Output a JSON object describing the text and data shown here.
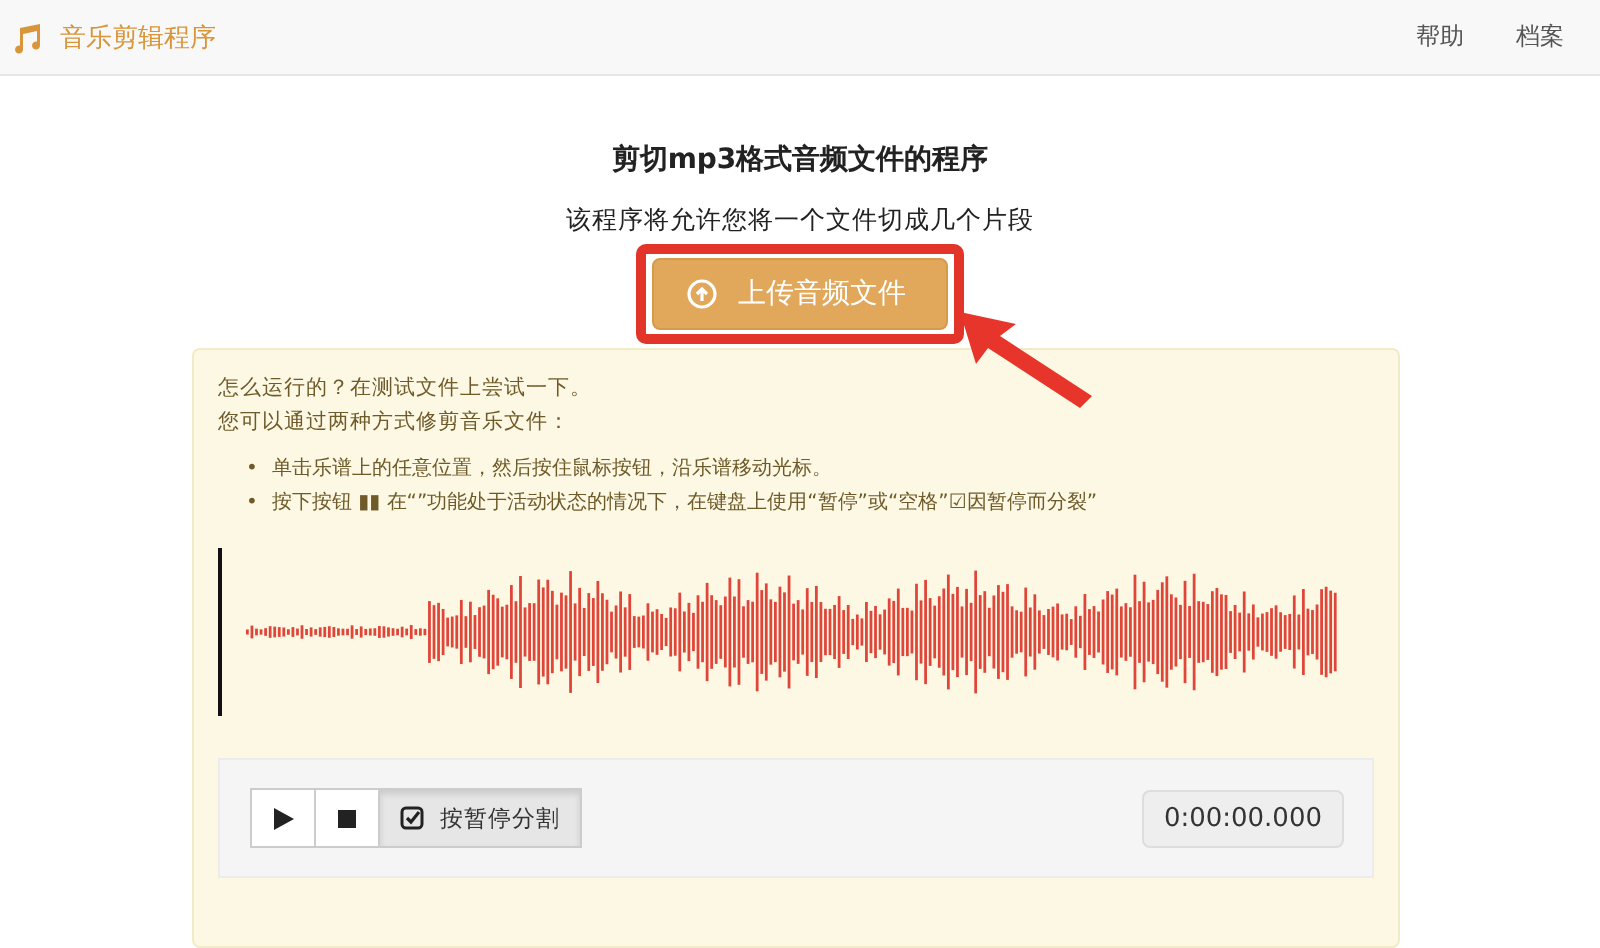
{
  "navbar": {
    "brand": "音乐剪辑程序",
    "links": [
      "帮助",
      "档案"
    ]
  },
  "heading": "剪切mp3格式音频文件的程序",
  "subtitle": "该程序将允许您将一个文件切成几个片段",
  "upload_button": {
    "label": "上传音频文件",
    "highlighted": true
  },
  "instructions": {
    "lines": [
      "怎么运行的？在测试文件上尝试一下。",
      "您可以通过两种方式修剪音乐文件："
    ],
    "bullets": [
      {
        "marker": "•",
        "text": "单击乐谱上的任意位置，然后按住鼠标按钮，沿乐谱移动光标。"
      },
      {
        "marker": "•",
        "text": "按下按钮 ▮▮ 在“”功能处于活动状态的情况下，在键盘上使用“暂停”或“空格”☑因暂停而分裂”"
      }
    ]
  },
  "player": {
    "split_button": {
      "label": "按暂停分割",
      "checked": true
    },
    "time": "0:00:00.000"
  }
}
